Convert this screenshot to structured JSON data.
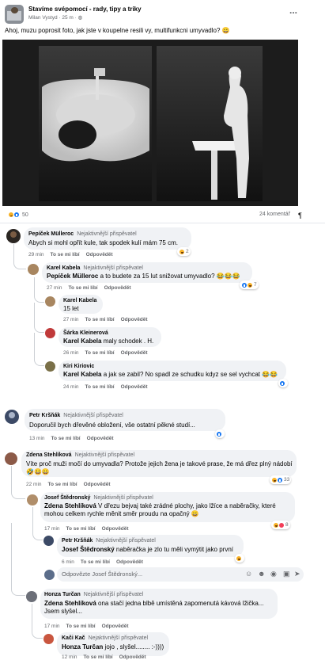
{
  "post": {
    "group": "Stavíme svépomocí - rady, tipy a triky",
    "author": "Milan Vystyd",
    "time": "25 m",
    "more": "...",
    "text": "Ahoj, muzu poprosit foto, jak jste v koupelne resili vy, multifunkcni umyvadlo? 😀",
    "reactions_count": "50",
    "comments_count": "24 komentář",
    "pilcrow": "¶"
  },
  "ui": {
    "like": "To se mi líbí",
    "reply": "Odpovědět",
    "reply_placeholder": "Odpovězte Josef Štědronský..."
  },
  "colors": {
    "link_blue": "#1877f2",
    "bubble": "#f0f2f5",
    "meta_gray": "#65676b"
  },
  "comments": [
    {
      "author": "Pepíček Mülleroc",
      "badge": "Nejaktivnější přispěvatel",
      "text": "Abych si mohl opřít kule, tak spodek kulí mám 75 cm.",
      "time": "29 min",
      "reactions": "2"
    },
    {
      "author": "Karel Kabela",
      "badge": "Nejaktivnější přispěvatel",
      "mention": "Pepíček Mülleroc",
      "text": " a to budete za 15 lut snižovat umyvadlo? 😂😂😂",
      "time": "27 min",
      "reactions": "7"
    },
    {
      "author": "Karel Kabela",
      "text": "15 let",
      "time": "27 min"
    },
    {
      "author": "Šárka Kleinerová",
      "mention": "Karel Kabela",
      "text": " maly schodek . H.",
      "time": "26 min"
    },
    {
      "author": "Kiri Kiriovic",
      "mention": "Karel Kabela",
      "text": " a jak se zabil? No spadl ze schudku kdyz se sel vychcat 😂😂",
      "time": "24 min"
    },
    {
      "author": "Petr Kršňák",
      "badge": "Nejaktivnější přispěvatel",
      "text": "Doporučil bych dřevěné obložení, vše ostatní pěkné studí...",
      "time": "13 min"
    },
    {
      "author": "Zdena Stehlíková",
      "badge": "Nejaktivnější přispěvatel",
      "text": "Víte proč muži močí do umyvadla? Protože jejich žena je takové prase, že má dřez plný nádobí 🤣😀😀",
      "time": "22 min",
      "reactions": "33"
    },
    {
      "author": "Josef Štědronský",
      "badge": "Nejaktivnější přispěvatel",
      "mention": "Zdena Stehlíková",
      "text": " V dřezu bejvaj také zrádné plochy, jako lžíce a naběračky, které mohou celkem rychle měnit směr proudu na opačný 😀",
      "time": "17 min",
      "reactions": "8"
    },
    {
      "author": "Petr Kršňák",
      "badge": "Nejaktivnější přispěvatel",
      "mention": "Josef Štědronský",
      "text": " naběračka je zlo tu měli vymýtit jako první",
      "time": "6 min"
    },
    {
      "author": "Honza Turčan",
      "badge": "Nejaktivnější přispěvatel",
      "mention": "Zdena Stehlíková",
      "text": " ona stačí jedna blbě umístěná zapomenutá kávová lžička... Jsem slyšel...",
      "time": "17 min"
    },
    {
      "author": "Kači Kač",
      "badge": "Nejaktivnější přispěvatel",
      "mention": "Honza Turčan",
      "text": " jojo , slyšel........ :-))))",
      "time": "12 min"
    }
  ]
}
